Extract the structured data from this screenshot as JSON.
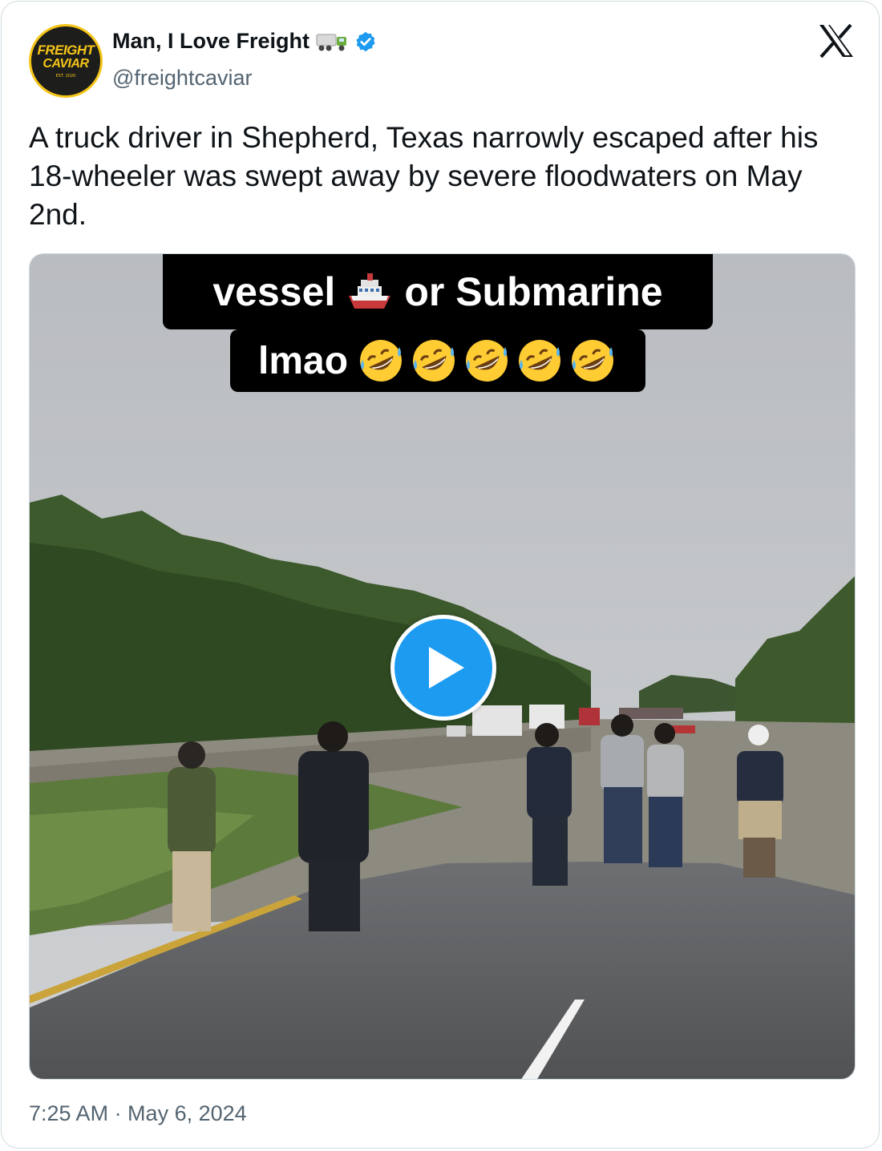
{
  "author": {
    "name": "Man, I Love Freight",
    "handle": "@freightcaviar",
    "avatar_text": [
      "FREIGHT",
      "CAVIAR",
      "EST. 2020"
    ],
    "name_emoji_icon": "articulated-lorry-icon",
    "verified": true,
    "verified_color": "#1d9bf0"
  },
  "platform_icon": "x-logo-icon",
  "tweet": {
    "text": "A truck driver in Shepherd, Texas narrowly escaped after his 18-wheeler was swept away by severe floodwaters on May 2nd.",
    "timestamp": "7:25 AM · May 6, 2024"
  },
  "media": {
    "type": "video",
    "caption_line1_a": "vessel",
    "caption_line1_icon": "ship-icon",
    "caption_line1_b": "or Submarine",
    "caption_line2": "lmao",
    "caption_line2_icons": [
      "rofl-emoji-icon",
      "rofl-emoji-icon",
      "rofl-emoji-icon",
      "rofl-emoji-icon",
      "rofl-emoji-icon"
    ],
    "play_button_icon": "play-icon",
    "accent": "#1d9bf0"
  }
}
